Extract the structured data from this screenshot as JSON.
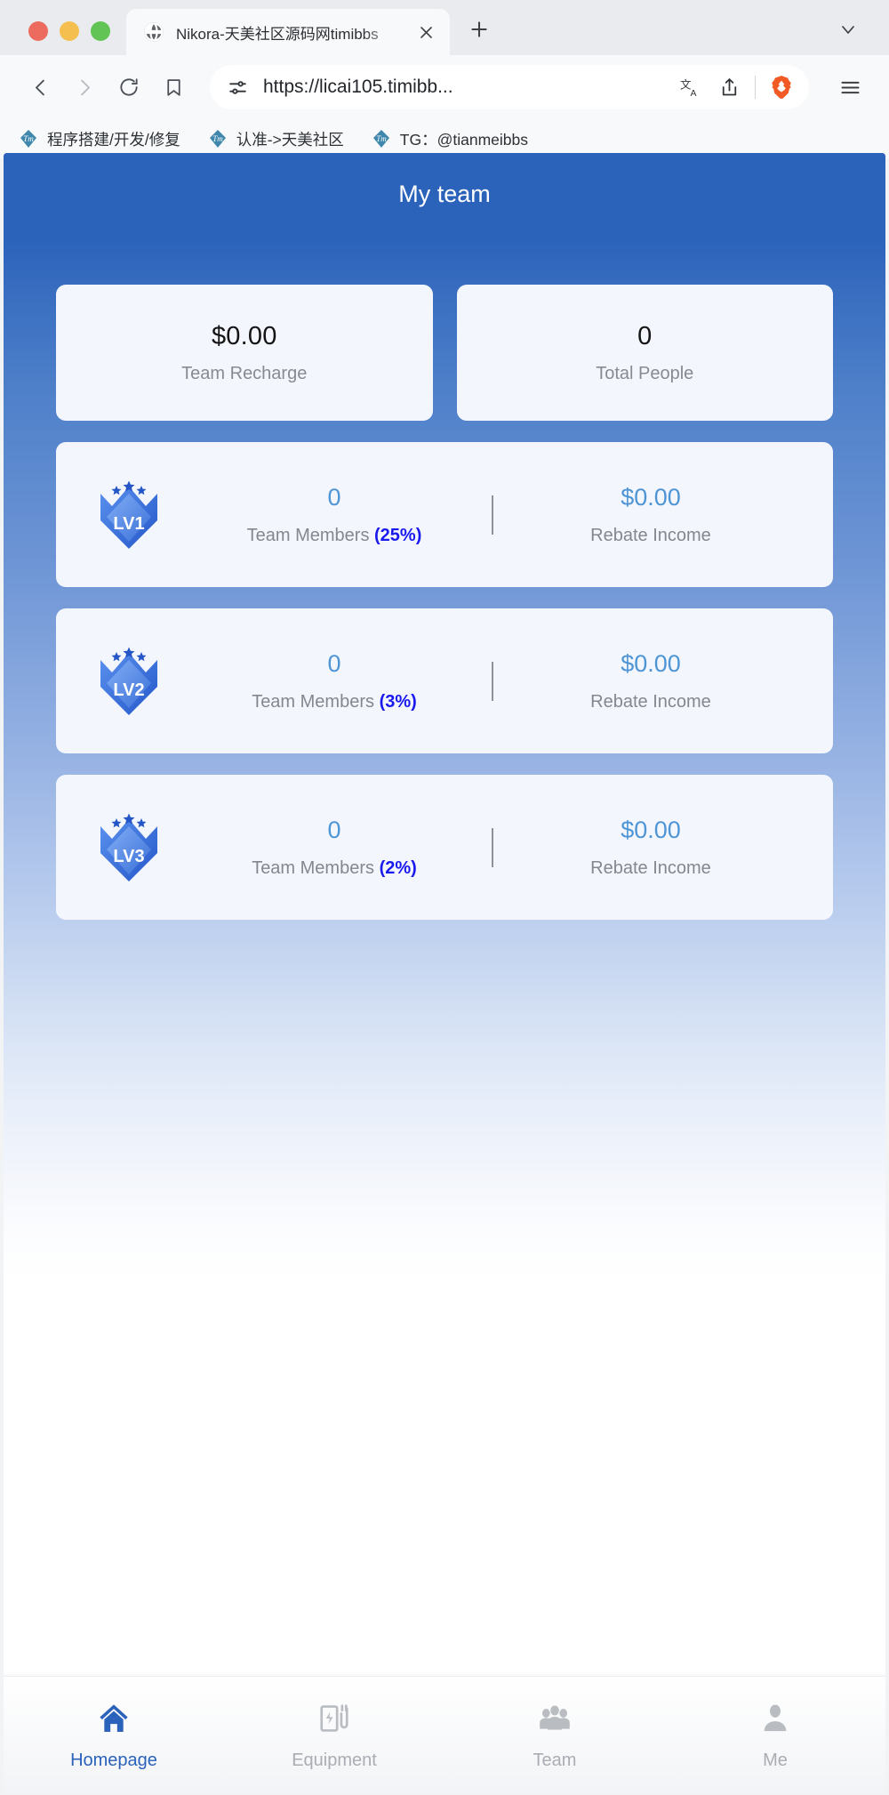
{
  "browser": {
    "tab": {
      "title": "Nikora-天美社区源码网timibbs",
      "favicon_icon": "globe-icon",
      "close_icon": "close-icon"
    },
    "new_tab_icon": "plus-icon",
    "tab_list_icon": "chevron-down-icon",
    "toolbar": {
      "back_icon": "back-arrow-icon",
      "forward_icon": "forward-arrow-icon",
      "reload_icon": "reload-icon",
      "bookmark_icon": "bookmark-icon",
      "permissions_icon": "site-settings-icon",
      "url": "https://licai105.timibb...",
      "translate_icon": "translate-icon",
      "share_icon": "share-icon",
      "brave_icon": "brave-lion-icon",
      "menu_icon": "hamburger-menu-icon"
    },
    "bookmarks": [
      {
        "label": "程序搭建/开发/修复",
        "icon": "tm-site-icon"
      },
      {
        "label": "认准->天美社区",
        "icon": "tm-site-icon"
      },
      {
        "label": "TG：@tianmeibbs",
        "icon": "tm-site-icon"
      }
    ]
  },
  "page": {
    "header": {
      "title": "My team"
    },
    "stats": [
      {
        "value": "$0.00",
        "label": "Team Recharge"
      },
      {
        "value": "0",
        "label": "Total People"
      }
    ],
    "levels": [
      {
        "badge": "LV1",
        "members_count": "0",
        "members_label": "Team Members",
        "percent": "(25%)",
        "rebate_value": "$0.00",
        "rebate_label": "Rebate Income"
      },
      {
        "badge": "LV2",
        "members_count": "0",
        "members_label": "Team Members",
        "percent": "(3%)",
        "rebate_value": "$0.00",
        "rebate_label": "Rebate Income"
      },
      {
        "badge": "LV3",
        "members_count": "0",
        "members_label": "Team Members",
        "percent": "(2%)",
        "rebate_value": "$0.00",
        "rebate_label": "Rebate Income"
      }
    ],
    "tabbar": [
      {
        "label": "Homepage",
        "icon": "home-icon",
        "active": true
      },
      {
        "label": "Equipment",
        "icon": "charging-station-icon",
        "active": false
      },
      {
        "label": "Team",
        "icon": "people-group-icon",
        "active": false
      },
      {
        "label": "Me",
        "icon": "person-icon",
        "active": false
      }
    ]
  },
  "colors": {
    "header_blue": "#2b62ba",
    "card_bg": "#f4f6fd",
    "accent_blue": "#4e95d6",
    "percent_blue": "#1a1aee",
    "muted_text": "#868b91"
  }
}
